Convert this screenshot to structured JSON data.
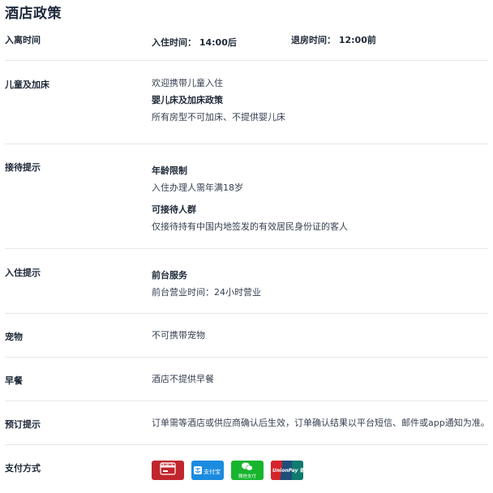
{
  "page": {
    "title": "酒店政策"
  },
  "checkin_checkout": {
    "label": "入离时间",
    "checkin": "入住时间： 14:00后",
    "checkout": "退房时间： 12:00前"
  },
  "children_beds": {
    "label": "儿童及加床",
    "line1": "欢迎携带儿童入住",
    "subtitle": "婴儿床及加床政策",
    "line2": "所有房型不可加床、不提供婴儿床"
  },
  "reception": {
    "label": "接待提示",
    "age_title": "年龄限制",
    "age_text": "入住办理人需年满18岁",
    "guests_title": "可接待人群",
    "guests_text": "仅接待持有中国内地签发的有效居民身份证的客人"
  },
  "checkin_tips": {
    "label": "入住提示",
    "front_title": "前台服务",
    "front_text": "前台营业时间：24小时营业"
  },
  "pets": {
    "label": "宠物",
    "text": "不可携带宠物"
  },
  "breakfast": {
    "label": "早餐",
    "text": "酒店不提供早餐"
  },
  "booking": {
    "label": "预订提示",
    "text": "订单需等酒店或供应商确认后生效，订单确认结果以平台短信、邮件或app通知为准。"
  },
  "payment": {
    "label": "支付方式",
    "methods": [
      {
        "icon": "credit-card-icon",
        "text": "信用卡",
        "color": "#c0262d"
      },
      {
        "icon": "alipay-icon",
        "text": "支付宝",
        "color": "#1b8be0"
      },
      {
        "icon": "wechat-pay-icon",
        "text": "微信支付",
        "color": "#17b52e"
      },
      {
        "icon": "unionpay-icon",
        "text": "UnionPay 银联",
        "color": "#1f4e79"
      }
    ]
  }
}
